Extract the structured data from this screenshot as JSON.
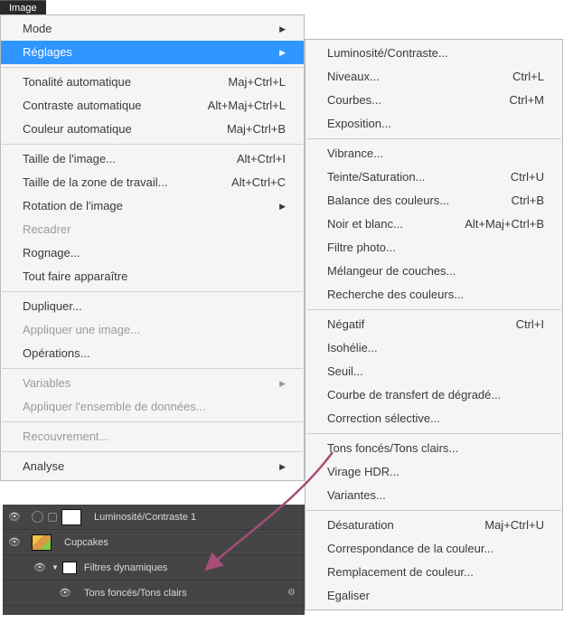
{
  "tab": "Image",
  "left": {
    "g1": [
      {
        "l": "Mode",
        "a": true
      },
      {
        "l": "Réglages",
        "a": true,
        "hl": true
      }
    ],
    "g2": [
      {
        "l": "Tonalité automatique",
        "s": "Maj+Ctrl+L"
      },
      {
        "l": "Contraste automatique",
        "s": "Alt+Maj+Ctrl+L"
      },
      {
        "l": "Couleur automatique",
        "s": "Maj+Ctrl+B"
      }
    ],
    "g3": [
      {
        "l": "Taille de l'image...",
        "s": "Alt+Ctrl+I"
      },
      {
        "l": "Taille de la zone de travail...",
        "s": "Alt+Ctrl+C"
      },
      {
        "l": "Rotation de l'image",
        "a": true
      },
      {
        "l": "Recadrer",
        "dis": true
      },
      {
        "l": "Rognage..."
      },
      {
        "l": "Tout faire apparaître"
      }
    ],
    "g4": [
      {
        "l": "Dupliquer..."
      },
      {
        "l": "Appliquer une image...",
        "dis": true
      },
      {
        "l": "Opérations..."
      }
    ],
    "g5": [
      {
        "l": "Variables",
        "a": true,
        "dis": true
      },
      {
        "l": "Appliquer l'ensemble de données...",
        "dis": true
      }
    ],
    "g6": [
      {
        "l": "Recouvrement...",
        "dis": true
      }
    ],
    "g7": [
      {
        "l": "Analyse",
        "a": true
      }
    ]
  },
  "right": {
    "g1": [
      {
        "l": "Luminosité/Contraste..."
      },
      {
        "l": "Niveaux...",
        "s": "Ctrl+L"
      },
      {
        "l": "Courbes...",
        "s": "Ctrl+M"
      },
      {
        "l": "Exposition..."
      }
    ],
    "g2": [
      {
        "l": "Vibrance..."
      },
      {
        "l": "Teinte/Saturation...",
        "s": "Ctrl+U"
      },
      {
        "l": "Balance des couleurs...",
        "s": "Ctrl+B"
      },
      {
        "l": "Noir et blanc...",
        "s": "Alt+Maj+Ctrl+B"
      },
      {
        "l": "Filtre photo..."
      },
      {
        "l": "Mélangeur de couches..."
      },
      {
        "l": "Recherche des couleurs..."
      }
    ],
    "g3": [
      {
        "l": "Négatif",
        "s": "Ctrl+I"
      },
      {
        "l": "Isohélie..."
      },
      {
        "l": "Seuil..."
      },
      {
        "l": "Courbe de transfert de dégradé..."
      },
      {
        "l": "Correction sélective..."
      }
    ],
    "g4": [
      {
        "l": "Tons foncés/Tons clairs..."
      },
      {
        "l": "Virage HDR..."
      },
      {
        "l": "Variantes..."
      }
    ],
    "g5": [
      {
        "l": "Désaturation",
        "s": "Maj+Ctrl+U"
      },
      {
        "l": "Correspondance de la couleur..."
      },
      {
        "l": "Remplacement de couleur..."
      },
      {
        "l": "Egaliser"
      }
    ]
  },
  "layers": {
    "r1": "Luminosité/Contraste 1",
    "r2": "Cupcakes",
    "r3": "Filtres dynamiques",
    "r4": "Tons foncés/Tons clairs"
  }
}
